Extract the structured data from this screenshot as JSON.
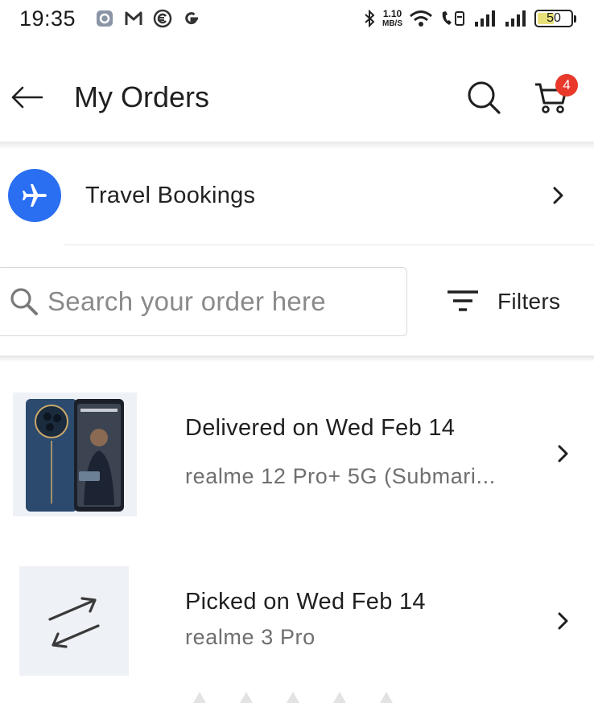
{
  "status_bar": {
    "time": "19:35",
    "left_icons": [
      "settings-app-icon",
      "gmail-icon",
      "c-app-icon",
      "google-icon"
    ],
    "net_speed_value": "1.10",
    "net_speed_unit": "MB/S",
    "battery_level": "50",
    "battery_fraction": 0.5
  },
  "header": {
    "title": "My Orders",
    "cart_count": "4"
  },
  "travel": {
    "label": "Travel Bookings"
  },
  "search": {
    "placeholder": "Search your order here",
    "filters_label": "Filters"
  },
  "orders": [
    {
      "status": "Delivered on Wed Feb 14",
      "name": "realme 12 Pro+ 5G (Submari...",
      "thumb_label": "realme 12 Pro+ 5G"
    },
    {
      "status": "Picked on Wed Feb 14",
      "name": "realme 3 Pro"
    }
  ],
  "colors": {
    "accent_blue": "#2a6ff2",
    "badge_red": "#e8392b",
    "phone_blue": "#2b4a6e"
  }
}
